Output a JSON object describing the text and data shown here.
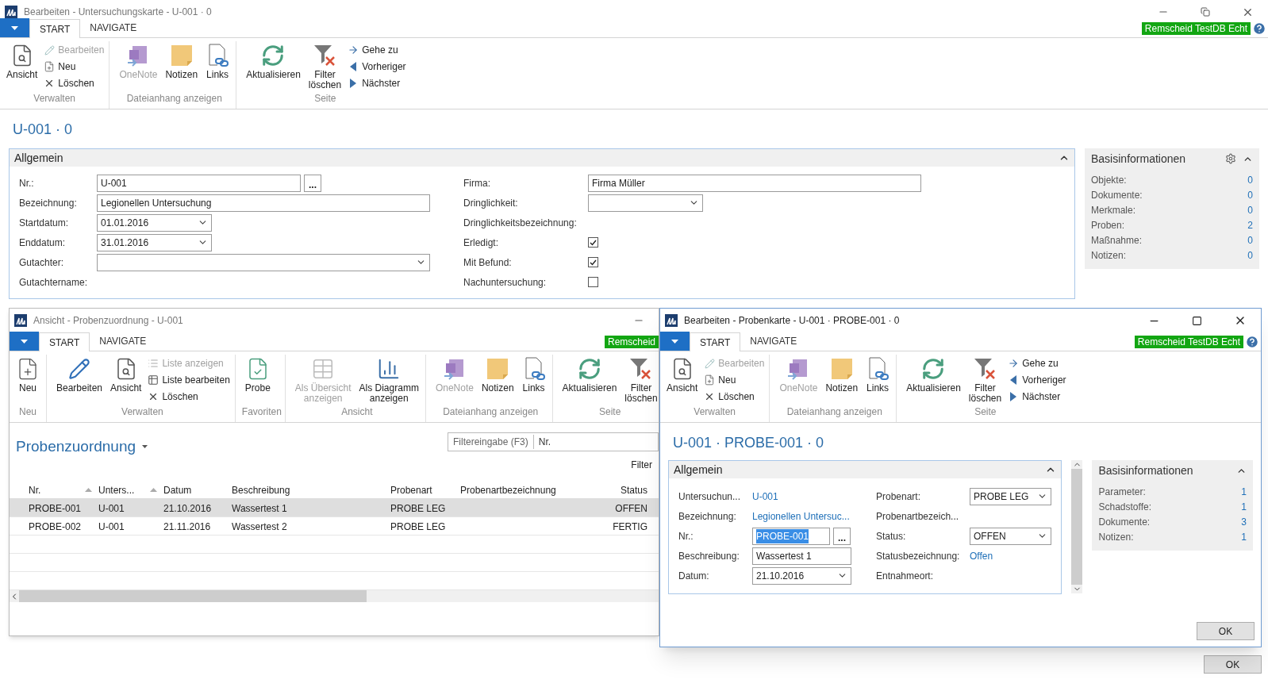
{
  "window": {
    "title": "Bearbeiten - Untersuchungskarte - U-001 · 0"
  },
  "ribbon": {
    "tabs": [
      {
        "label": "START",
        "selected": true
      },
      {
        "label": "NAVIGATE",
        "selected": false
      }
    ],
    "env_badge": "Remscheid TestDB Echt",
    "groups": [
      {
        "label": "Verwalten",
        "items": [
          {
            "label": "Ansicht",
            "kind": "large",
            "disabled": false
          },
          {
            "label": "Bearbeiten",
            "kind": "small",
            "disabled": true
          },
          {
            "label": "Neu",
            "kind": "small",
            "disabled": false
          },
          {
            "label": "Löschen",
            "kind": "small",
            "disabled": false
          }
        ]
      },
      {
        "label": "Dateianhang anzeigen",
        "items": [
          {
            "label": "OneNote",
            "kind": "large",
            "disabled": true
          },
          {
            "label": "Notizen",
            "kind": "large",
            "disabled": false
          },
          {
            "label": "Links",
            "kind": "large",
            "disabled": false
          }
        ]
      },
      {
        "label": "Seite",
        "items": [
          {
            "label": "Aktualisieren",
            "kind": "large",
            "disabled": false
          },
          {
            "label": "Filter\nlöschen",
            "kind": "large",
            "disabled": false
          },
          {
            "label": "Gehe zu",
            "kind": "small",
            "disabled": false
          },
          {
            "label": "Vorheriger",
            "kind": "small",
            "disabled": false
          },
          {
            "label": "Nächster",
            "kind": "small",
            "disabled": false
          }
        ]
      }
    ]
  },
  "page_title": "U-001 · 0",
  "general": {
    "title": "Allgemein",
    "left_fields": [
      {
        "label": "Nr.:",
        "kind": "lookup",
        "value": "U-001",
        "assist": "..."
      },
      {
        "label": "Bezeichnung:",
        "kind": "text",
        "value": "Legionellen Untersuchung"
      },
      {
        "label": "Startdatum:",
        "kind": "date",
        "value": "01.01.2016"
      },
      {
        "label": "Enddatum:",
        "kind": "date",
        "value": "31.01.2016"
      },
      {
        "label": "Gutachter:",
        "kind": "combobox"
      },
      {
        "label": "Gutachtername:",
        "kind": "readonly"
      }
    ],
    "right_fields": [
      {
        "label": "Firma:",
        "kind": "text",
        "value": "Firma Müller"
      },
      {
        "label": "Dringlichkeit:",
        "kind": "dropdown"
      },
      {
        "label": "Dringlichkeitsbezeichnung:",
        "kind": "readonly"
      },
      {
        "label": "Erledigt:",
        "kind": "checkbox",
        "checked": true
      },
      {
        "label": "Mit Befund:",
        "kind": "checkbox",
        "checked": true
      },
      {
        "label": "Nachuntersuchung:",
        "kind": "checkbox",
        "checked": false
      }
    ]
  },
  "fact_box": {
    "title": "Basisinformationen",
    "rows": [
      {
        "label": "Objekte:",
        "value": "0"
      },
      {
        "label": "Dokumente:",
        "value": "0"
      },
      {
        "label": "Merkmale:",
        "value": "0"
      },
      {
        "label": "Proben:",
        "value": "2"
      },
      {
        "label": "Maßnahme:",
        "value": "0"
      },
      {
        "label": "Notizen:",
        "value": "0"
      }
    ]
  },
  "list_window": {
    "title": "Ansicht - Probenzuordnung - U-001",
    "ribbon": {
      "tabs": [
        {
          "label": "START",
          "selected": true
        },
        {
          "label": "NAVIGATE",
          "selected": false
        }
      ],
      "env_badge": "Remscheid",
      "groups": [
        {
          "label": "Neu",
          "items": [
            {
              "label": "Neu",
              "kind": "large",
              "disabled": false
            }
          ]
        },
        {
          "label": "Verwalten",
          "items": [
            {
              "label": "Bearbeiten",
              "kind": "large",
              "disabled": false
            },
            {
              "label": "Ansicht",
              "kind": "large",
              "disabled": false
            },
            {
              "label": "Liste anzeigen",
              "kind": "small",
              "disabled": true
            },
            {
              "label": "Liste bearbeiten",
              "kind": "small",
              "disabled": false
            },
            {
              "label": "Löschen",
              "kind": "small",
              "disabled": false
            }
          ]
        },
        {
          "label": "Favoriten",
          "items": [
            {
              "label": "Probe",
              "kind": "large",
              "disabled": false
            }
          ]
        },
        {
          "label": "Ansicht",
          "items": [
            {
              "label": "Als Übersicht\nanzeigen",
              "kind": "large",
              "disabled": true
            },
            {
              "label": "Als Diagramm\nanzeigen",
              "kind": "large",
              "disabled": false
            }
          ]
        },
        {
          "label": "Dateianhang anzeigen",
          "items": [
            {
              "label": "OneNote",
              "kind": "large",
              "disabled": true
            },
            {
              "label": "Notizen",
              "kind": "large",
              "disabled": false
            },
            {
              "label": "Links",
              "kind": "large",
              "disabled": false
            }
          ]
        },
        {
          "label": "Seite",
          "items": [
            {
              "label": "Aktualisieren",
              "kind": "large",
              "disabled": false
            },
            {
              "label": "Filter\nlöschen",
              "kind": "large",
              "disabled": false
            }
          ]
        }
      ]
    },
    "page_title": "Probenzuordnung",
    "filter": {
      "label": "Filtereingabe (F3)",
      "field": "Nr."
    },
    "filter_link": "Filter",
    "columns": [
      {
        "label": "Nr.",
        "sorted": true
      },
      {
        "label": "Unters...",
        "sorted": true
      },
      {
        "label": "Datum",
        "sorted": false
      },
      {
        "label": "Beschreibung",
        "sorted": false
      },
      {
        "label": "Probenart",
        "sorted": false
      },
      {
        "label": "Probenartbezeichnung",
        "sorted": false
      },
      {
        "label": "Status",
        "sorted": false
      }
    ],
    "rows": [
      {
        "cells": [
          "PROBE-001",
          "U-001",
          "21.10.2016",
          "Wassertest 1",
          "PROBE LEG",
          "",
          "OFFEN"
        ],
        "selected": true
      },
      {
        "cells": [
          "PROBE-002",
          "U-001",
          "21.11.2016",
          "Wassertest 2",
          "PROBE LEG",
          "",
          "FERTIG"
        ],
        "selected": false
      }
    ]
  },
  "card_window": {
    "title": "Bearbeiten - Probenkarte - U-001 · PROBE-001 · 0",
    "ribbon": {
      "tabs": [
        {
          "label": "START",
          "selected": true
        },
        {
          "label": "NAVIGATE",
          "selected": false
        }
      ],
      "env_badge": "Remscheid TestDB Echt",
      "groups": [
        {
          "label": "Verwalten",
          "items": [
            {
              "label": "Ansicht",
              "kind": "large",
              "disabled": false
            },
            {
              "label": "Bearbeiten",
              "kind": "small",
              "disabled": true
            },
            {
              "label": "Neu",
              "kind": "small",
              "disabled": false
            },
            {
              "label": "Löschen",
              "kind": "small",
              "disabled": false
            }
          ]
        },
        {
          "label": "Dateianhang anzeigen",
          "items": [
            {
              "label": "OneNote",
              "kind": "large",
              "disabled": true
            },
            {
              "label": "Notizen",
              "kind": "large",
              "disabled": false
            },
            {
              "label": "Links",
              "kind": "large",
              "disabled": false
            }
          ]
        },
        {
          "label": "Seite",
          "items": [
            {
              "label": "Aktualisieren",
              "kind": "large",
              "disabled": false
            },
            {
              "label": "Filter\nlöschen",
              "kind": "large",
              "disabled": false
            },
            {
              "label": "Gehe zu",
              "kind": "small",
              "disabled": false
            },
            {
              "label": "Vorheriger",
              "kind": "small",
              "disabled": false
            },
            {
              "label": "Nächster",
              "kind": "small",
              "disabled": false
            }
          ]
        }
      ]
    },
    "page_title": "U-001 · PROBE-001 · 0",
    "general": {
      "title": "Allgemein",
      "left_fields": [
        {
          "label": "Untersuchun...",
          "kind": "link",
          "value": "U-001"
        },
        {
          "label": "Bezeichnung:",
          "kind": "link",
          "value": "Legionellen Untersuc..."
        },
        {
          "label": "Nr.:",
          "kind": "lookup",
          "value": "PROBE-001",
          "assist": "...",
          "highlighted": true
        },
        {
          "label": "Beschreibung:",
          "kind": "text",
          "value": "Wassertest 1"
        },
        {
          "label": "Datum:",
          "kind": "date",
          "value": "21.10.2016"
        }
      ],
      "right_fields": [
        {
          "label": "Probenart:",
          "kind": "dropdown",
          "value": "PROBE LEG"
        },
        {
          "label": "Probenartbezeich...",
          "kind": "readonly"
        },
        {
          "label": "Status:",
          "kind": "dropdown",
          "value": "OFFEN"
        },
        {
          "label": "Statusbezeichnung:",
          "kind": "link",
          "value": "Offen"
        },
        {
          "label": "Entnahmeort:",
          "kind": "readonly"
        }
      ]
    },
    "fact_box": {
      "title": "Basisinformationen",
      "rows": [
        {
          "label": "Parameter:",
          "value": "1"
        },
        {
          "label": "Schadstoffe:",
          "value": "1"
        },
        {
          "label": "Dokumente:",
          "value": "3"
        },
        {
          "label": "Notizen:",
          "value": "1"
        }
      ]
    },
    "ok_button": "OK"
  },
  "ok_button": "OK"
}
